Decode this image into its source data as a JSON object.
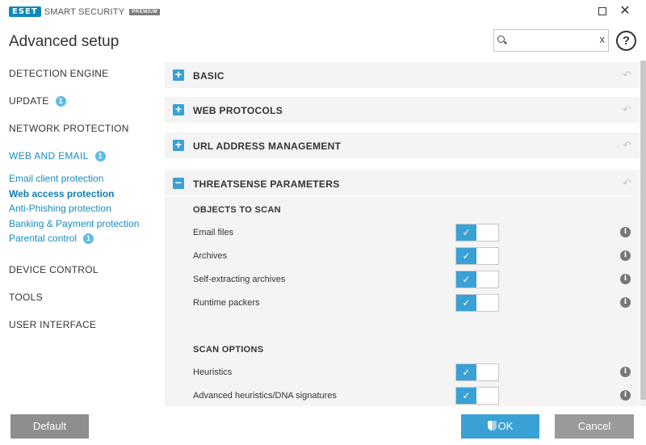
{
  "app": {
    "logo_brand": "ESET",
    "logo_product": "SMART SECURITY",
    "logo_edition": "PREMIUM",
    "window_maximize": "",
    "window_close": "✕"
  },
  "header": {
    "title": "Advanced setup",
    "search": {
      "value": "",
      "placeholder": "",
      "clear": "x"
    },
    "help": "?"
  },
  "sidebar": {
    "items": [
      {
        "label": "DETECTION ENGINE",
        "badge": ""
      },
      {
        "label": "UPDATE",
        "badge": "1"
      },
      {
        "label": "NETWORK PROTECTION",
        "badge": ""
      },
      {
        "label": "WEB AND EMAIL",
        "badge": "1"
      },
      {
        "label": "DEVICE CONTROL",
        "badge": ""
      },
      {
        "label": "TOOLS",
        "badge": ""
      },
      {
        "label": "USER INTERFACE",
        "badge": ""
      }
    ],
    "subitems": [
      {
        "label": "Email client protection",
        "badge": ""
      },
      {
        "label": "Web access protection",
        "badge": ""
      },
      {
        "label": "Anti-Phishing protection",
        "badge": ""
      },
      {
        "label": "Banking & Payment protection",
        "badge": ""
      },
      {
        "label": "Parental control",
        "badge": "1"
      }
    ]
  },
  "main": {
    "sections": [
      {
        "label": "BASIC",
        "toggle": "+",
        "expanded": false
      },
      {
        "label": "WEB PROTOCOLS",
        "toggle": "+",
        "expanded": false
      },
      {
        "label": "URL ADDRESS MANAGEMENT",
        "toggle": "+",
        "expanded": false
      },
      {
        "label": "THREATSENSE PARAMETERS",
        "toggle": "−",
        "expanded": true
      }
    ],
    "revert_icon": "↶",
    "objects_to_scan": {
      "heading": "OBJECTS TO SCAN",
      "rows": [
        {
          "label": "Email files",
          "enabled": true
        },
        {
          "label": "Archives",
          "enabled": true
        },
        {
          "label": "Self-extracting archives",
          "enabled": true
        },
        {
          "label": "Runtime packers",
          "enabled": true
        }
      ]
    },
    "scan_options": {
      "heading": "SCAN OPTIONS",
      "rows": [
        {
          "label": "Heuristics",
          "enabled": true
        },
        {
          "label": "Advanced heuristics/DNA signatures",
          "enabled": true
        }
      ]
    },
    "check_glyph": "✓",
    "info_glyph": "i"
  },
  "footer": {
    "default_label": "Default",
    "ok_label": "OK",
    "cancel_label": "Cancel"
  },
  "colors": {
    "accent": "#3aa1d5",
    "link": "#1a8bbf",
    "badge": "#5bbde8",
    "panel_bg": "#f4f4f4",
    "button_gray": "#8e8e8e"
  }
}
